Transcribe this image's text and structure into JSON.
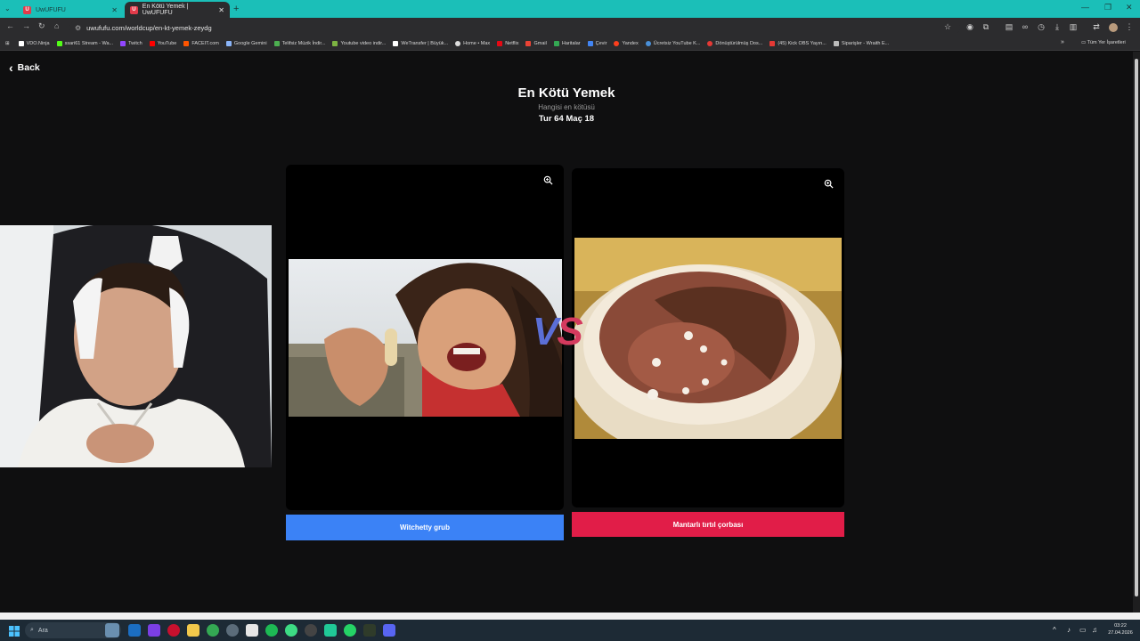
{
  "browser": {
    "tabs": [
      {
        "label": "UwUFUFU",
        "active": false
      },
      {
        "label": "En Kötü Yemek | UwUFUFU",
        "active": true
      }
    ],
    "url": "uwufufu.com/worldcup/en-kt-yemek-zeydg",
    "bookmarks": [
      "VDO.Ninja",
      "ssari61 Stream - Wa...",
      "Twitch",
      "YouTube",
      "FACEIT.com",
      "Google Gemini",
      "Telifsiz Müzik İndir...",
      "Youtube video indir...",
      "WeTransfer | Büyük...",
      "Home • Max",
      "Netflix",
      "Gmail",
      "Haritalar",
      "Çevir",
      "Yandex",
      "Ücretsiz YouTube K...",
      "Dönüştürülmüş Dos...",
      "(45) Kick OBS Yayın...",
      "Siparişler - Wraith E..."
    ],
    "bookmarks_right": "Tüm Yer İşaretleri"
  },
  "page": {
    "back_label": "Back",
    "title": "En Kötü Yemek",
    "subtitle": "Hangisi en kötüsü",
    "round": "Tur 64 Maç 18",
    "vs_v": "V",
    "vs_s": "S",
    "left_choice": {
      "label": "Witchetty grub",
      "color": "#3b82f6"
    },
    "right_choice": {
      "label": "Mantarlı tırtıl çorbası",
      "color": "#e11d48"
    }
  },
  "taskbar": {
    "search_placeholder": "Ara",
    "time": "03:22",
    "date": "27.04.2026"
  }
}
